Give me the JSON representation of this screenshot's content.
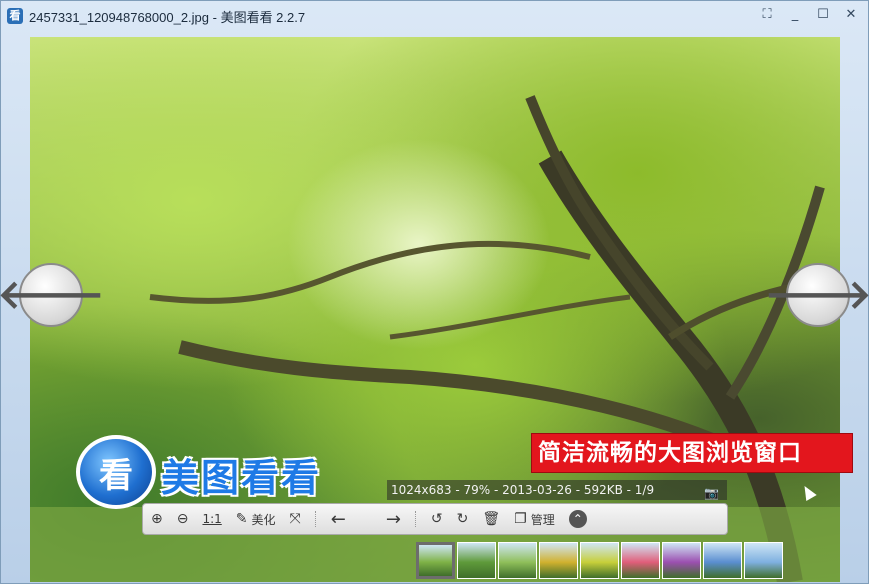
{
  "window": {
    "title": "2457331_120948768000_2.jpg - 美图看看 2.2.7",
    "app_icon": "看",
    "controls": {
      "fullscreen": "⛶",
      "minimize": "_",
      "maximize": "☐",
      "close": "✕"
    }
  },
  "viewer": {
    "prev_arrow": "🡐",
    "next_arrow": "🡒",
    "promo_text": "简洁流畅的大图浏览窗口",
    "logo_mark": "看",
    "logo_text": "美图看看",
    "info": "1024x683 - 79% - 2013-03-26 - 592KB - 1/9",
    "camera_icon": "camera-icon"
  },
  "toolbar": {
    "zoom_in": "⊕",
    "zoom_out": "⊖",
    "actual_size": "1:1",
    "beautify_icon": "✎",
    "beautify_label": "美化",
    "share_icon": "⤧",
    "prev": "←",
    "next": "→",
    "rotate_left": "↺",
    "rotate_right": "↻",
    "delete": "🗑",
    "manage_icon": "❐",
    "manage_label": "管理",
    "collapse": "⌃"
  },
  "thumbnails": {
    "count": 9,
    "selected_index": 0,
    "colors": [
      "#7fb247",
      "#5f9a3a",
      "#8fbf5a",
      "#d1b12f",
      "#c7cf3a",
      "#e05e7a",
      "#9b4fb0",
      "#5a8ed0",
      "#7fb0e0"
    ]
  }
}
